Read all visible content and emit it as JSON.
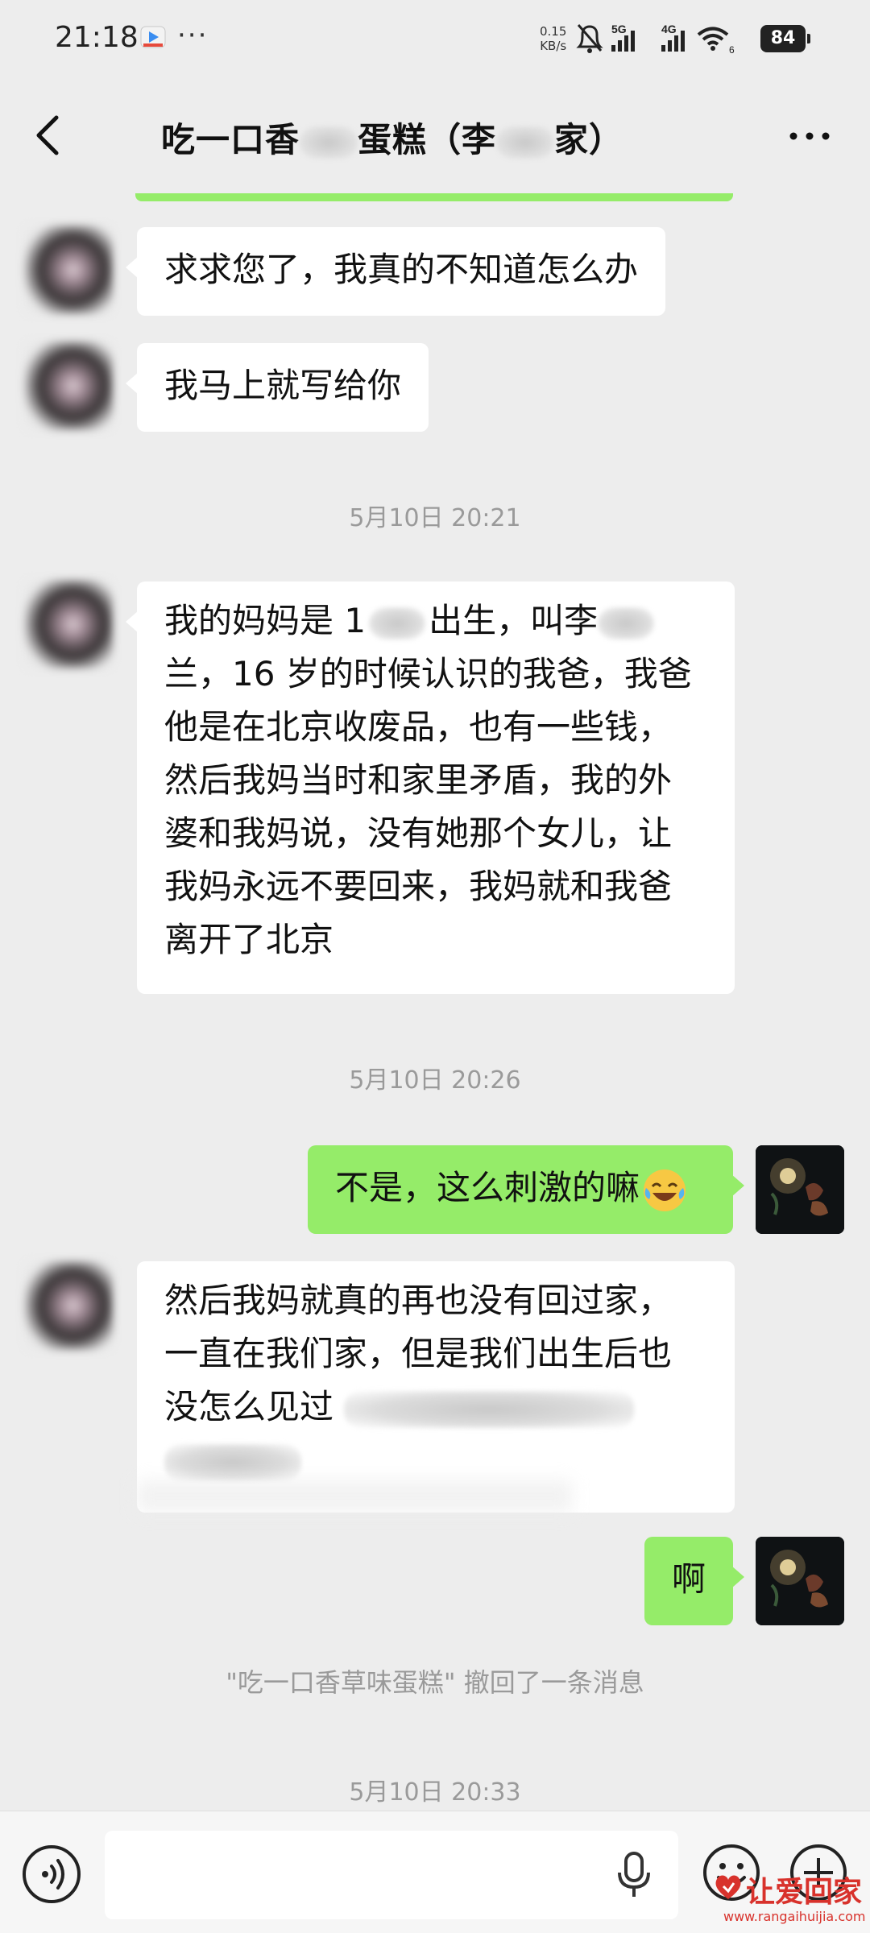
{
  "status_bar": {
    "time": "21:18",
    "more": "···",
    "net_speed_value": "0.15",
    "net_speed_unit": "KB/s",
    "signal_5g": "5G",
    "signal_4g": "4G",
    "wifi_sub": "6",
    "battery": "84"
  },
  "header": {
    "title_part1": "吃一口香",
    "title_part2": "蛋糕（李",
    "title_part3": "家）"
  },
  "messages": [
    {
      "text": "求求您了，我真的不知道怎么办"
    },
    {
      "text": "我马上就写给你"
    },
    {
      "time": "5月10日 20:21"
    },
    {
      "lines": [
        "我的妈妈是 1",
        "兰，16 岁的时候认识的我爸，我爸",
        "他是在北京收废品，也有一些钱，",
        "然后我妈当时和家里矛盾，我的外",
        "婆和我妈说，没有她那个女儿，让",
        "我妈永远不要回来，我妈就和我爸",
        "离开了北京"
      ],
      "line1_tail": "出生，叫李"
    },
    {
      "time": "5月10日 20:26"
    },
    {
      "text": "不是，这么刺激的嘛"
    },
    {
      "lines": [
        "然后我妈就真的再也没有回过家，",
        "一直在我们家，但是我们出生后也",
        "没怎么见过",
        ""
      ]
    },
    {
      "text": "啊"
    },
    {
      "system": "\"吃一口香草味蛋糕\" 撤回了一条消息"
    },
    {
      "time": "5月10日 20:33"
    }
  ],
  "watermark": {
    "brand": "让爱回家",
    "url": "www.rangaihuijia.com"
  },
  "colors": {
    "background": "#ededed",
    "outgoing_bubble": "#95ec69",
    "incoming_bubble": "#ffffff",
    "timestamp": "#9a9a9a",
    "watermark": "#d8322c"
  }
}
